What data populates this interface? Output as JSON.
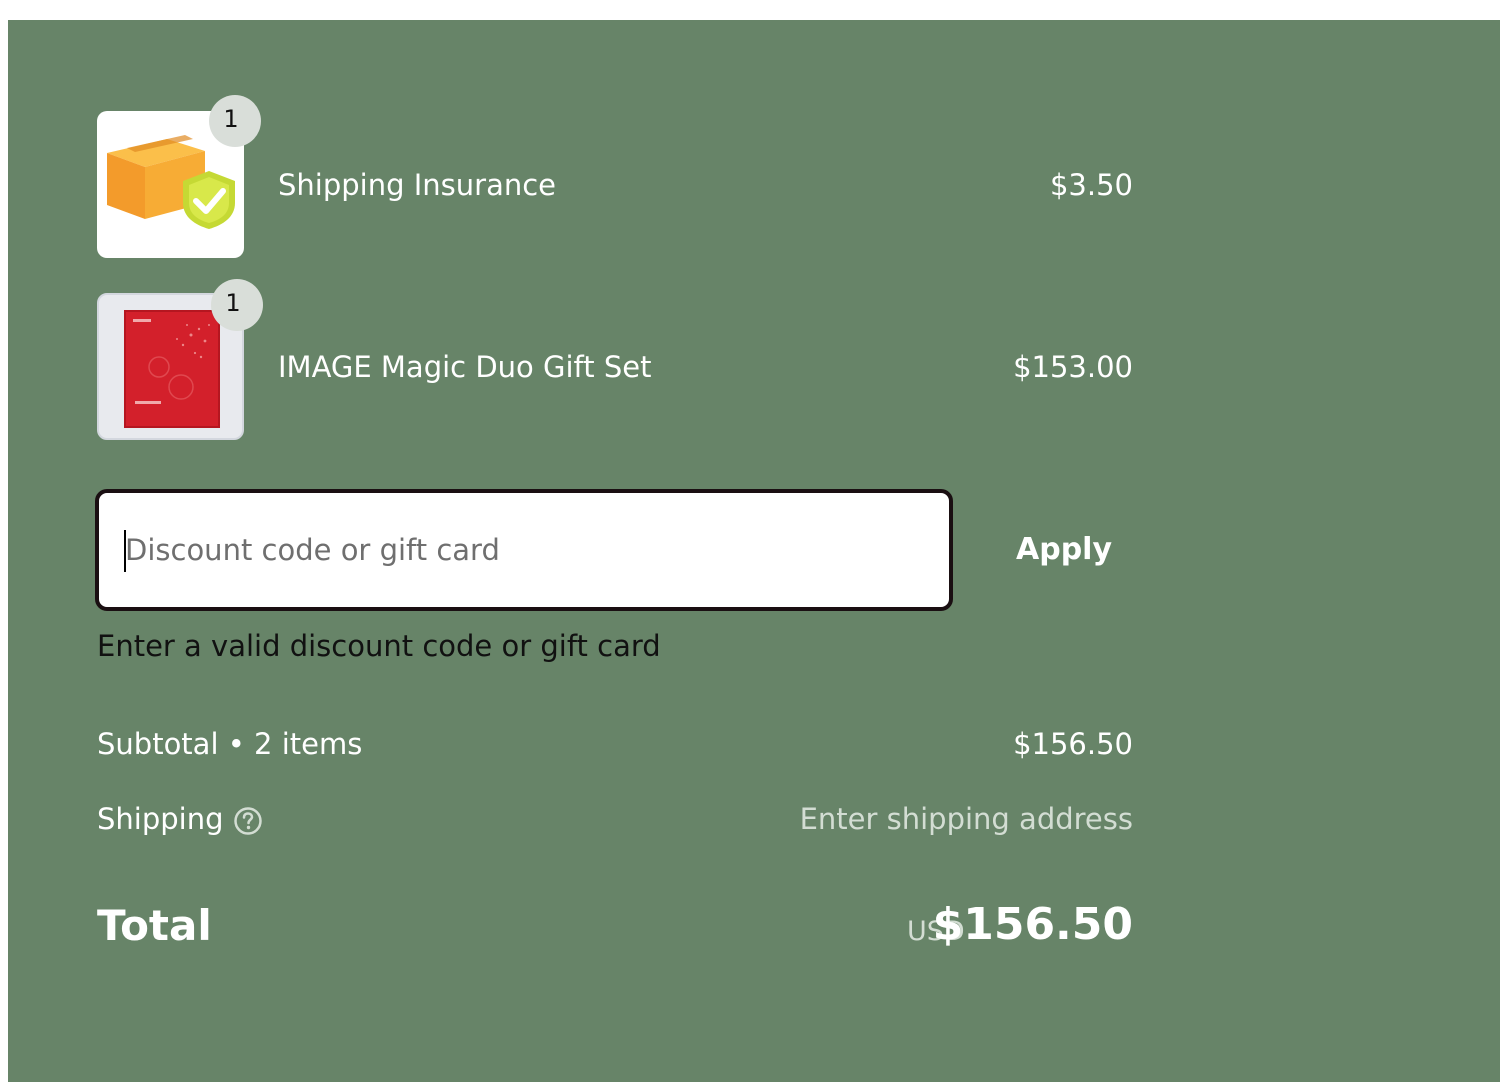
{
  "line_items": [
    {
      "quantity": "1",
      "title": "Shipping Insurance",
      "price": "$3.50",
      "image_icon": "shipping-insurance-box-icon"
    },
    {
      "quantity": "1",
      "title": "IMAGE Magic Duo Gift Set",
      "price": "$153.00",
      "image_icon": "red-gift-box-image"
    }
  ],
  "discount": {
    "placeholder": "Discount code or gift card",
    "value": "",
    "apply_label": "Apply",
    "error_message": "Enter a valid discount code or gift card"
  },
  "totals": {
    "subtotal_label": "Subtotal • 2 items",
    "subtotal_value": "$156.50",
    "shipping_label": "Shipping",
    "shipping_value": "Enter shipping address",
    "total_label": "Total",
    "currency": "USD",
    "total_value": "$156.50"
  },
  "colors": {
    "panel_background": "#678468",
    "input_border": "#1a0f12",
    "badge_background": "#d9ded9"
  }
}
